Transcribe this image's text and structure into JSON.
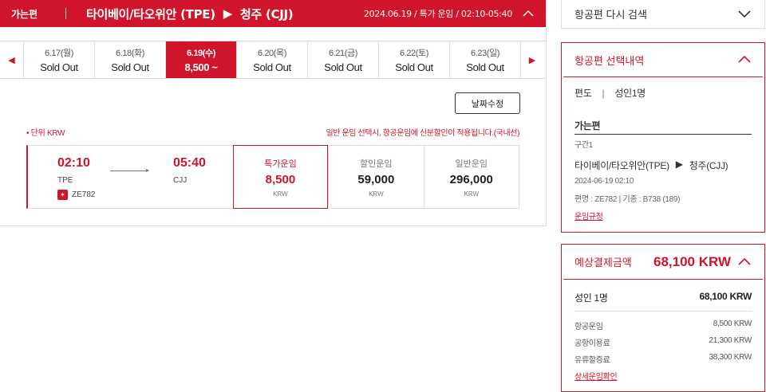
{
  "topbar": {
    "direction": "가는편",
    "route_from": "타이베이/타오위안 (TPE)",
    "route_to": "청주 (CJJ)",
    "meta": "2024.06.19 / 특가 운임 / 02:10-05:40"
  },
  "dates": [
    {
      "date": "6.17(월)",
      "price": "Sold Out"
    },
    {
      "date": "6.18(화)",
      "price": "Sold Out"
    },
    {
      "date": "6.19(수)",
      "price": "8,500 ~"
    },
    {
      "date": "6.20(목)",
      "price": "Sold Out"
    },
    {
      "date": "6.21(금)",
      "price": "Sold Out"
    },
    {
      "date": "6.22(토)",
      "price": "Sold Out"
    },
    {
      "date": "6.23(일)",
      "price": "Sold Out"
    }
  ],
  "modify_label": "날짜수정",
  "unit_label": "• 단위 KRW",
  "notice": "일반 운임 선택시, 항공운임에 신분할인이 적용됩니다.(국내선)",
  "flight": {
    "dep_time": "02:10",
    "dep_code": "TPE",
    "arr_time": "05:40",
    "arr_code": "CJJ",
    "flight_no": "ZE782"
  },
  "fares": [
    {
      "name": "특가운임",
      "value": "8,500",
      "unit": "KRW"
    },
    {
      "name": "할인운임",
      "value": "59,000",
      "unit": "KRW"
    },
    {
      "name": "일반운임",
      "value": "296,000",
      "unit": "KRW"
    }
  ],
  "side": {
    "research_label": "항공편 다시 검색",
    "selection_title": "항공편 선택내역",
    "trip_type": "편도",
    "trip_sep": "|",
    "passengers": "성인1명",
    "segment_title": "가는편",
    "segment_sub": "구간1",
    "segment_route_from": "타이베이/타오위안(TPE)",
    "segment_route_to": "청주(CJJ)",
    "segment_datetime": "2024-06-19 02:10",
    "segment_flight": "편명 : ZE782  |  기종 : B738 (189)",
    "fare_rule": "운임규정",
    "payment_title": "예상결제금액",
    "payment_total": "68,100 KRW",
    "pax_label": "성인 1명",
    "pax_amount": "68,100 KRW",
    "items": [
      {
        "label": "항공운임",
        "amount": "8,500 KRW"
      },
      {
        "label": "공항이용료",
        "amount": "21,300 KRW"
      },
      {
        "label": "유류할증료",
        "amount": "38,300 KRW"
      }
    ],
    "detail_link": "상세운임확인"
  },
  "colors": {
    "accent": "#d0142b"
  }
}
